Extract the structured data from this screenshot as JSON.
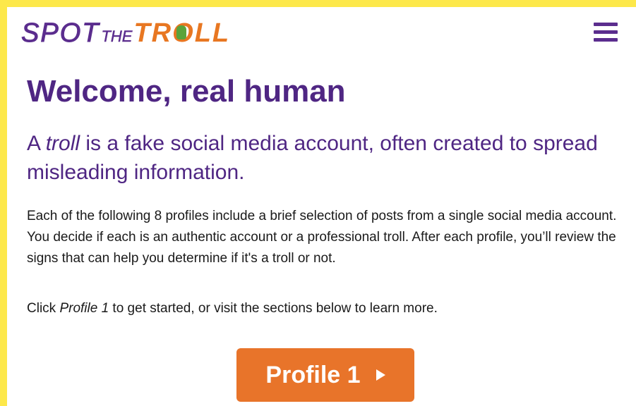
{
  "logo": {
    "spot": "SPOT",
    "the": "THE",
    "troll_tr": "TR",
    "troll_o": "O",
    "troll_ll": "LL"
  },
  "menu": {
    "icon": "hamburger-menu-icon"
  },
  "main": {
    "heading": "Welcome, real human",
    "subtitle_prefix": "A ",
    "subtitle_em": "troll",
    "subtitle_rest": " is a fake social media account, often created to spread misleading information.",
    "body": "Each of the following 8 profiles include a brief selection of posts from a single social media account. You decide if each is an authentic account or a professional troll. After each profile, you’ll review the signs that can help you determine if it's a troll or not.",
    "cta_prefix": "Click ",
    "cta_em": "Profile 1",
    "cta_rest": " to get started, or visit the sections below to learn more.",
    "button_label": "Profile 1",
    "button_icon": "play-arrow-icon"
  },
  "colors": {
    "page_border": "#fde84a",
    "brand_purple": "#4f2683",
    "brand_orange": "#e8742a",
    "troll_green": "#5aa33b"
  }
}
